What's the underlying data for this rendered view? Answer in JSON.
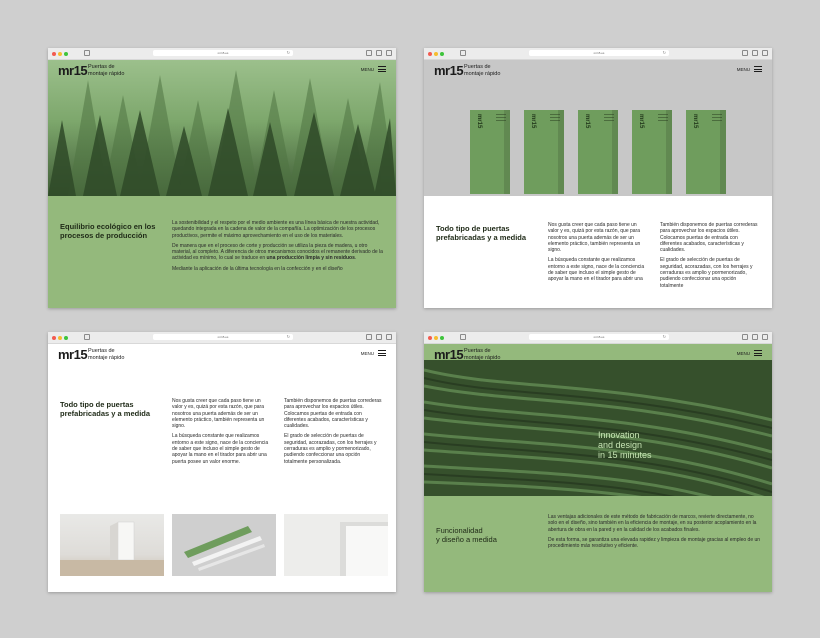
{
  "browser": {
    "url": "mr15.es"
  },
  "brand": {
    "logo": "mr15",
    "tagline_line1": "Puertas de",
    "tagline_line2": "montaje rápido",
    "menu_label": "MENU"
  },
  "colors": {
    "green": "#94b97c",
    "dark_green": "#36502c",
    "box_green": "#6f9d5d"
  },
  "screen1": {
    "title": "Equilibrio ecológico en los procesos de producción",
    "p1": "La sostenibilidad y el respeto por el medio ambiente es una línea básica de nuestra actividad, quedando integrada en la cadena de valor de la compañía. La optimización de los procesos productivos, permite el máximo aprovechamiento en el uso de los materiales.",
    "p2_start": "De manera que en el proceso de corte y producción se utiliza la pieza de madera, u otro material, al completo. A diferencia de otros mecanismos conocidos el remanente derivado de la actividad es mínimo, lo cual se traduce en ",
    "p2_bold": "una producción limpia y sin residuos",
    "p2_end": ".",
    "p3": "Mediante la aplicación de la última tecnología en la confección y en el diseño"
  },
  "screen2": {
    "title": "Todo tipo de puertas prefabricadas y a medida",
    "box_label": "mr15",
    "col1_p1": "Nos gusta creer que cada paso tiene un valor y es, quizá por esta razón, que para nosotros una puerta además de ser un elemento práctico, también representa un signo.",
    "col1_p2": "La búsqueda constante que realizamos entorno a este signo, nace de la conciencia de saber que incluso el simple gesto de apoyar la mano en el tirador para abrir una",
    "col2_p1": "También disponemos de puertas correderas para aprovechar los espacios útiles. Colocamos puertas de entrada con diferentes acabados, características y cualidades.",
    "col2_p2": "El grado de selección de puertas de seguridad, acorazadas, con los herrajes y cerraduras es amplio y pormenorizado, pudiendo confeccionar una opción totalmente"
  },
  "screen3": {
    "title": "Todo tipo de puertas prefabricadas y a medida",
    "col1_p1": "Nos gusta creer que cada paso tiene un valor y es, quizá por esta razón, que para nosotros una puerta además de ser un elemento práctico, también representa un signo.",
    "col1_p2": "La búsqueda constante que realizamos entorno a este signo, nace de la conciencia de saber que incluso el simple gesto de apoyar la mano en el tirador para abrir una puerta posee un valor enorme.",
    "col2_p1": "También disponemos de puertas correderas para aprovechar los espacios útiles. Colocamos puertas de entrada con diferentes acabados, características y cualidades.",
    "col2_p2": "El grado de selección de puertas de seguridad, acorazadas, con los herrajes y cerraduras es amplio y pormenorizado, pudiendo confeccionar una opción totalmente personalizada."
  },
  "screen4": {
    "hero_line1": "Innovation",
    "hero_line2": "and design",
    "hero_line3": "in 15 minutes",
    "title_line1": "Funcionalidad",
    "title_line2": "y diseño a medida",
    "p1": "Las ventajas adicionales de este método de fabricación de marcos, revierte directamente, no solo en el diseño, sino también en la eficiencia de montaje, en su posterior acoplamiento en la abertura de obra en la pared y en la calidad de los acabados finales.",
    "p2": "De esta forma, se garantiza una elevada rapidez y limpieza de montaje gracias al empleo de un procedimiento más resolutivo y eficiente."
  }
}
